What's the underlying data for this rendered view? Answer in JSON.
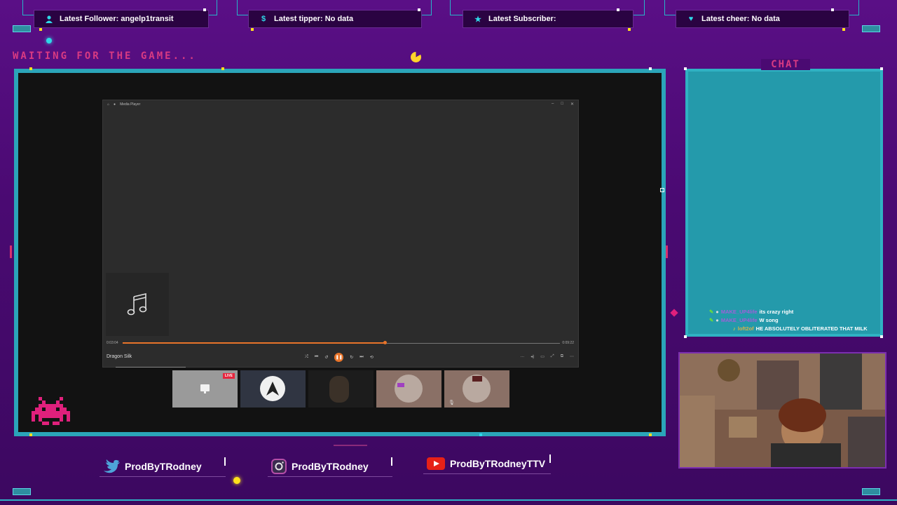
{
  "alerts": [
    {
      "label": "Latest Follower: angelp1transit",
      "icon": "user-icon"
    },
    {
      "label": "Latest tipper: No data",
      "icon": "dollar-icon"
    },
    {
      "label": "Latest Subscriber:",
      "icon": "star-icon"
    },
    {
      "label": "Latest cheer: No data",
      "icon": "heart-icon"
    }
  ],
  "waiting_text": "WAITING FOR THE GAME...",
  "media_player": {
    "title": "Media Player",
    "time_elapsed": "0:03:04",
    "time_total": "0:09:22",
    "progress": 0.6,
    "song": "Dragon Silk"
  },
  "call": {
    "live_badge": "LIVE"
  },
  "chat": {
    "title": "CHAT",
    "messages": [
      {
        "user": "MAKE_UP4life",
        "text": "its crazy right"
      },
      {
        "user": "MAKE_UP4life",
        "text": "W song"
      },
      {
        "user": "loft2of",
        "text": "HE ABSOLUTELY OBLITERATED THAT MILK"
      }
    ]
  },
  "socials": [
    {
      "name": "ProdByTRodney",
      "icon": "twitter-icon"
    },
    {
      "name": "ProdByTRodney",
      "icon": "instagram-icon"
    },
    {
      "name": "ProdByTRodneyTTV",
      "icon": "youtube-icon"
    }
  ],
  "colors": {
    "background": "#4a0a72",
    "frame": "#2ba5b9",
    "accent_pink": "#d83a82",
    "accent_orange": "#e8742a",
    "chat_bg": "#249aab"
  }
}
